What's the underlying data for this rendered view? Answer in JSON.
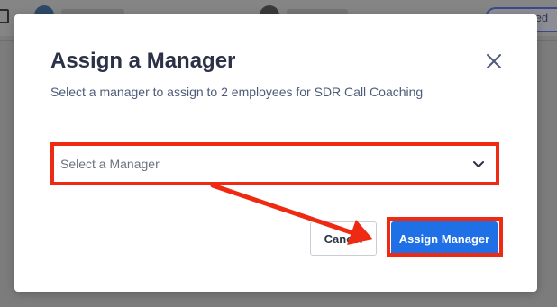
{
  "modal": {
    "title": "Assign a Manager",
    "subtitle": "Select a manager to assign to 2 employees for SDR Call Coaching",
    "select": {
      "placeholder": "Select a Manager"
    },
    "buttons": {
      "cancel": "Cancel",
      "assign": "Assign Manager"
    }
  },
  "background": {
    "status_pill": "ted"
  },
  "colors": {
    "primary": "#1f6fe6",
    "annotation": "#ee2a12",
    "title": "#2b3146",
    "subtitle": "#4e5b78"
  },
  "icons": {
    "close": "close-icon",
    "chevron": "chevron-down-icon"
  }
}
